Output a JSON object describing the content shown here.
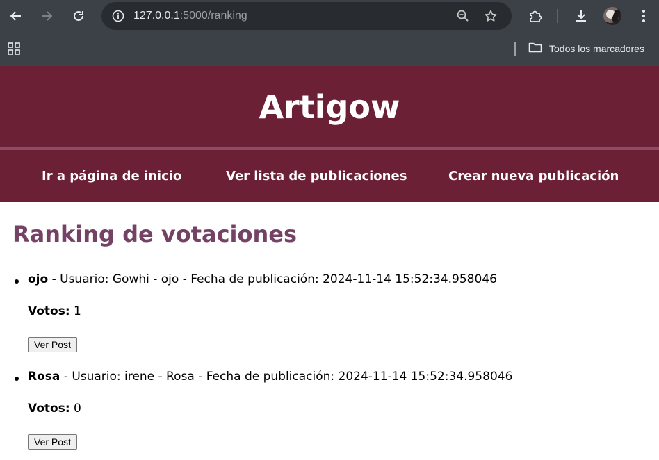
{
  "browser": {
    "url_host": "127.0.0.1",
    "url_path": ":5000/ranking",
    "bookmarks_label": "Todos los marcadores",
    "icons": [
      "back-icon",
      "forward-icon",
      "reload-icon",
      "info-icon",
      "zoom-icon",
      "star-icon",
      "extensions-icon",
      "download-icon",
      "menu-icon",
      "apps-icon",
      "folder-icon"
    ]
  },
  "site": {
    "title": "Artigow",
    "colors": {
      "header": "#6b2035",
      "divider": "#8d4b66",
      "heading": "#744265"
    }
  },
  "nav": {
    "home": "Ir a página de inicio",
    "list": "Ver lista de publicaciones",
    "create": "Crear nueva publicación"
  },
  "page": {
    "heading": "Ranking de votaciones"
  },
  "posts": [
    {
      "title": "ojo",
      "details": " - Usuario: Gowhi - ojo - Fecha de publicación: 2024-11-14 15:52:34.958046",
      "votes_label": "Votos:",
      "votes_value": " 1",
      "button_label": "Ver Post"
    },
    {
      "title": "Rosa",
      "details": " - Usuario: irene - Rosa - Fecha de publicación: 2024-11-14 15:52:34.958046",
      "votes_label": "Votos:",
      "votes_value": " 0",
      "button_label": "Ver Post"
    }
  ]
}
